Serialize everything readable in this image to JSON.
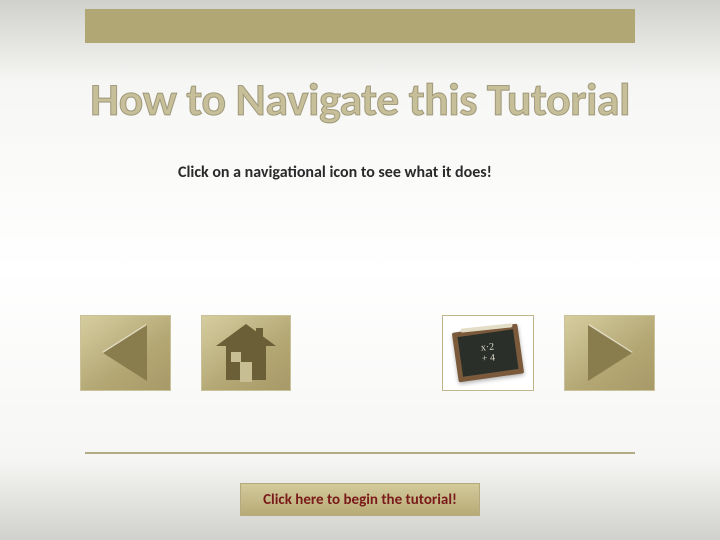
{
  "title": "How to Navigate this Tutorial",
  "subtitle": "Click on a navigational icon to see what it does!",
  "begin_button": "Click here to begin the tutorial!",
  "chalkboard": {
    "line1": "x·2",
    "line2": "+ 4"
  }
}
